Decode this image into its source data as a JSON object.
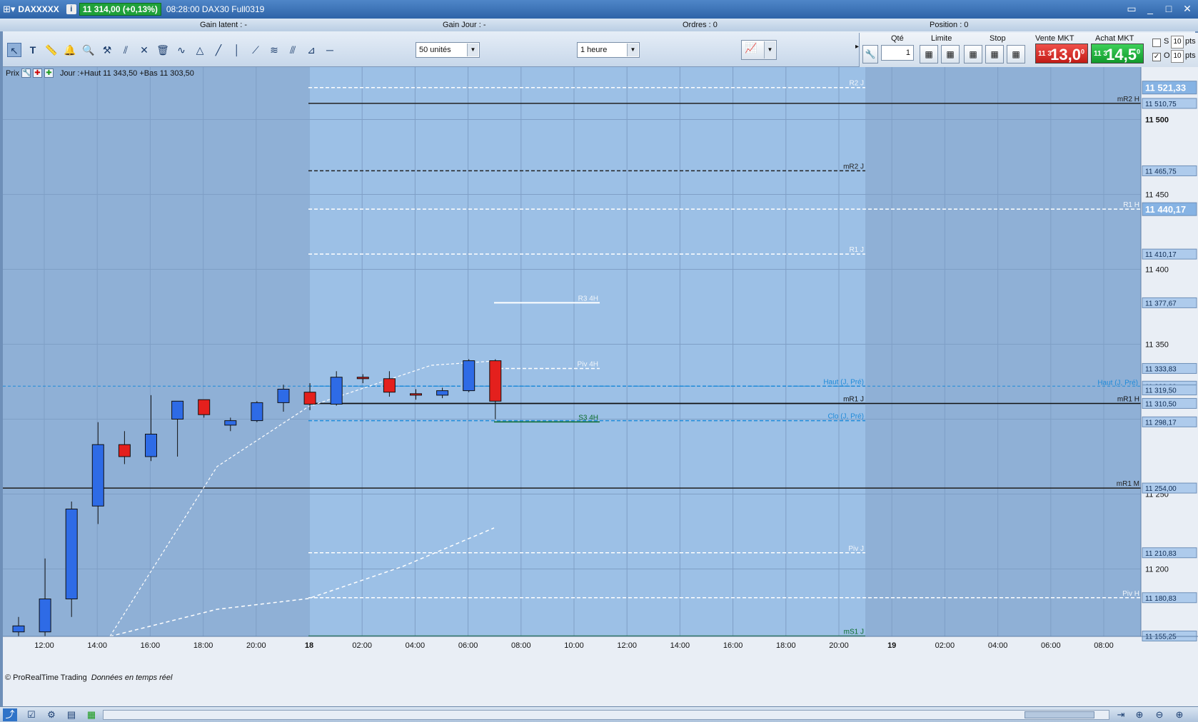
{
  "titlebar": {
    "symbol": "DAXXXXX",
    "info": "i",
    "price_badge": "11 314,00 (+0,13%)",
    "time_and_name": "08:28:00  DAX30 Full0319",
    "controls": [
      "▭",
      "_",
      "□",
      "✕"
    ]
  },
  "gainbar": {
    "gain_latent": "Gain latent :  -",
    "gain_jour": "Gain Jour :  -",
    "ordres": "Ordres :  0",
    "position": "Position :  0"
  },
  "toolbar": {
    "units": "50 unités",
    "timeframe": "1 heure",
    "tools": [
      "cursor-arrow",
      "text",
      "ruler",
      "bell",
      "zoom",
      "hammer",
      "fibonacci",
      "cross-lines",
      "trash",
      "zigzag",
      "triangle",
      "trend-line",
      "vertical-line",
      "ray",
      "wave",
      "channel",
      "graph-tool",
      "horizontal-line"
    ]
  },
  "orderpanel": {
    "qty_label": "Qté",
    "qty_value": "1",
    "limit_label": "Limite",
    "stop_label": "Stop",
    "sell_label": "Vente MKT",
    "buy_label": "Achat MKT",
    "sell_small": "11 3",
    "sell_big": "13,0",
    "sell_sup": "0",
    "buy_small": "11 3",
    "buy_big": "14,5",
    "buy_sup": "0",
    "s_label": "S",
    "o_label": "O",
    "pts_value": "10",
    "pts_label": "pts"
  },
  "pane": {
    "prix": "Prix",
    "info": "Jour :+Haut 11 343,50 +Bas 11 303,50"
  },
  "footer_note": {
    "brand": "© ProRealTime Trading",
    "realtime": "Données en temps réel"
  },
  "chart_data": {
    "type": "candlestick",
    "ylim": [
      11155,
      11535
    ],
    "x_ticks": [
      {
        "label": "12:00",
        "bold": false
      },
      {
        "label": "14:00",
        "bold": false
      },
      {
        "label": "16:00",
        "bold": false
      },
      {
        "label": "18:00",
        "bold": false
      },
      {
        "label": "20:00",
        "bold": false
      },
      {
        "label": "18",
        "bold": true
      },
      {
        "label": "02:00",
        "bold": false
      },
      {
        "label": "04:00",
        "bold": false
      },
      {
        "label": "06:00",
        "bold": false
      },
      {
        "label": "08:00",
        "bold": false
      },
      {
        "label": "10:00",
        "bold": false
      },
      {
        "label": "12:00",
        "bold": false
      },
      {
        "label": "14:00",
        "bold": false
      },
      {
        "label": "16:00",
        "bold": false
      },
      {
        "label": "18:00",
        "bold": false
      },
      {
        "label": "20:00",
        "bold": false
      },
      {
        "label": "19",
        "bold": true
      },
      {
        "label": "02:00",
        "bold": false
      },
      {
        "label": "04:00",
        "bold": false
      },
      {
        "label": "06:00",
        "bold": false
      },
      {
        "label": "08:00",
        "bold": false
      }
    ],
    "y_ticks": [
      11500,
      11450,
      11400,
      11350,
      11250,
      11200
    ],
    "candles": [
      {
        "o": 11158,
        "h": 11168,
        "l": 11155,
        "c": 11162
      },
      {
        "o": 11158,
        "h": 11207,
        "l": 11155,
        "c": 11180
      },
      {
        "o": 11180,
        "h": 11245,
        "l": 11168,
        "c": 11240
      },
      {
        "o": 11242,
        "h": 11298,
        "l": 11230,
        "c": 11283
      },
      {
        "o": 11283,
        "h": 11292,
        "l": 11270,
        "c": 11275
      },
      {
        "o": 11275,
        "h": 11316,
        "l": 11272,
        "c": 11290
      },
      {
        "o": 11300,
        "h": 11309,
        "l": 11275,
        "c": 11312
      },
      {
        "o": 11313,
        "h": 11301,
        "l": 11303,
        "c": 11303
      },
      {
        "o": 11296,
        "h": 11301,
        "l": 11292,
        "c": 11299
      },
      {
        "o": 11299,
        "h": 11312,
        "l": 11298,
        "c": 11311
      },
      {
        "o": 11311,
        "h": 11323,
        "l": 11305,
        "c": 11320
      },
      {
        "o": 11318,
        "h": 11324,
        "l": 11306,
        "c": 11310
      },
      {
        "o": 11310,
        "h": 11332,
        "l": 11309,
        "c": 11328
      },
      {
        "o": 11328,
        "h": 11330,
        "l": 11324,
        "c": 11327
      },
      {
        "o": 11327,
        "h": 11332,
        "l": 11315,
        "c": 11318
      },
      {
        "o": 11317,
        "h": 11320,
        "l": 11313,
        "c": 11316
      },
      {
        "o": 11316,
        "h": 11321,
        "l": 11314,
        "c": 11319
      },
      {
        "o": 11319,
        "h": 11340,
        "l": 11318,
        "c": 11339
      },
      {
        "o": 11339,
        "h": 11340,
        "l": 11300,
        "c": 11312
      }
    ],
    "levels": [
      {
        "label": "R2 J",
        "value": 11521.33,
        "color": "#ffffff",
        "dash": true
      },
      {
        "label": "mR2 H",
        "value": 11510.75,
        "color": "#222222",
        "dash": false
      },
      {
        "label": "mR2 J",
        "value": 11465.75,
        "color": "#222222",
        "dash": true
      },
      {
        "label": "R1 H",
        "value": 11440.17,
        "color": "#ffffff",
        "dash": true
      },
      {
        "label": "R1 J",
        "value": 11410.17,
        "color": "#ffffff",
        "dash": true
      },
      {
        "label": "R3 4H",
        "value": 11377.67,
        "color": "#ffffff",
        "dash": false
      },
      {
        "label": "Piv 4H",
        "value": 11333.83,
        "color": "#ffffff",
        "dash": true
      },
      {
        "label": "Haut (J, Pré)",
        "value": 11322.0,
        "color": "#1f8ad8",
        "dash": true
      },
      {
        "label": "mR1 J",
        "value": 11310.5,
        "color": "#111111",
        "dash": false
      },
      {
        "label": "mR1 H",
        "value": 11310.5,
        "color": "#111111",
        "dash": false
      },
      {
        "label": "Clo (J, Pré)",
        "value": 11299.0,
        "color": "#1f8ad8",
        "dash": true
      },
      {
        "label": "S3 4H",
        "value": 11298.17,
        "color": "#0a6b2a",
        "dash": false
      },
      {
        "label": "mR1 M",
        "value": 11254.0,
        "color": "#222222",
        "dash": false
      },
      {
        "label": "Piv J",
        "value": 11210.83,
        "color": "#ffffff",
        "dash": true
      },
      {
        "label": "Piv H",
        "value": 11180.83,
        "color": "#ffffff",
        "dash": true
      },
      {
        "label": "mS1 J",
        "value": 11155.25,
        "color": "#0a6b2a",
        "dash": false
      }
    ],
    "price_tags": [
      {
        "text": "11 521,33",
        "big": true
      },
      {
        "text": "11 510,75",
        "big": false
      },
      {
        "text": "11 465,75",
        "big": false
      },
      {
        "text": "11 440,17",
        "big": true
      },
      {
        "text": "11 410,17",
        "big": false
      },
      {
        "text": "11 377,67",
        "big": false
      },
      {
        "text": "11 333,83",
        "big": false
      },
      {
        "text": "11 322,00",
        "big": false
      },
      {
        "text": "11 319,50",
        "big": false
      },
      {
        "text": "11 310,50",
        "big": false
      },
      {
        "text": "11 298,17",
        "big": false
      },
      {
        "text": "11 254,00",
        "big": false
      },
      {
        "text": "11 210,83",
        "big": false
      },
      {
        "text": "11 180,83",
        "big": false
      },
      {
        "text": "11 155,25",
        "big": false
      }
    ],
    "right_labels": [
      "Haut (J, Pré)",
      "mR1 H"
    ]
  },
  "colors": {
    "bg_past": "#96b6da",
    "bg_future": "#8fb3dd",
    "up": "#2e6be6",
    "down": "#e4201d"
  }
}
